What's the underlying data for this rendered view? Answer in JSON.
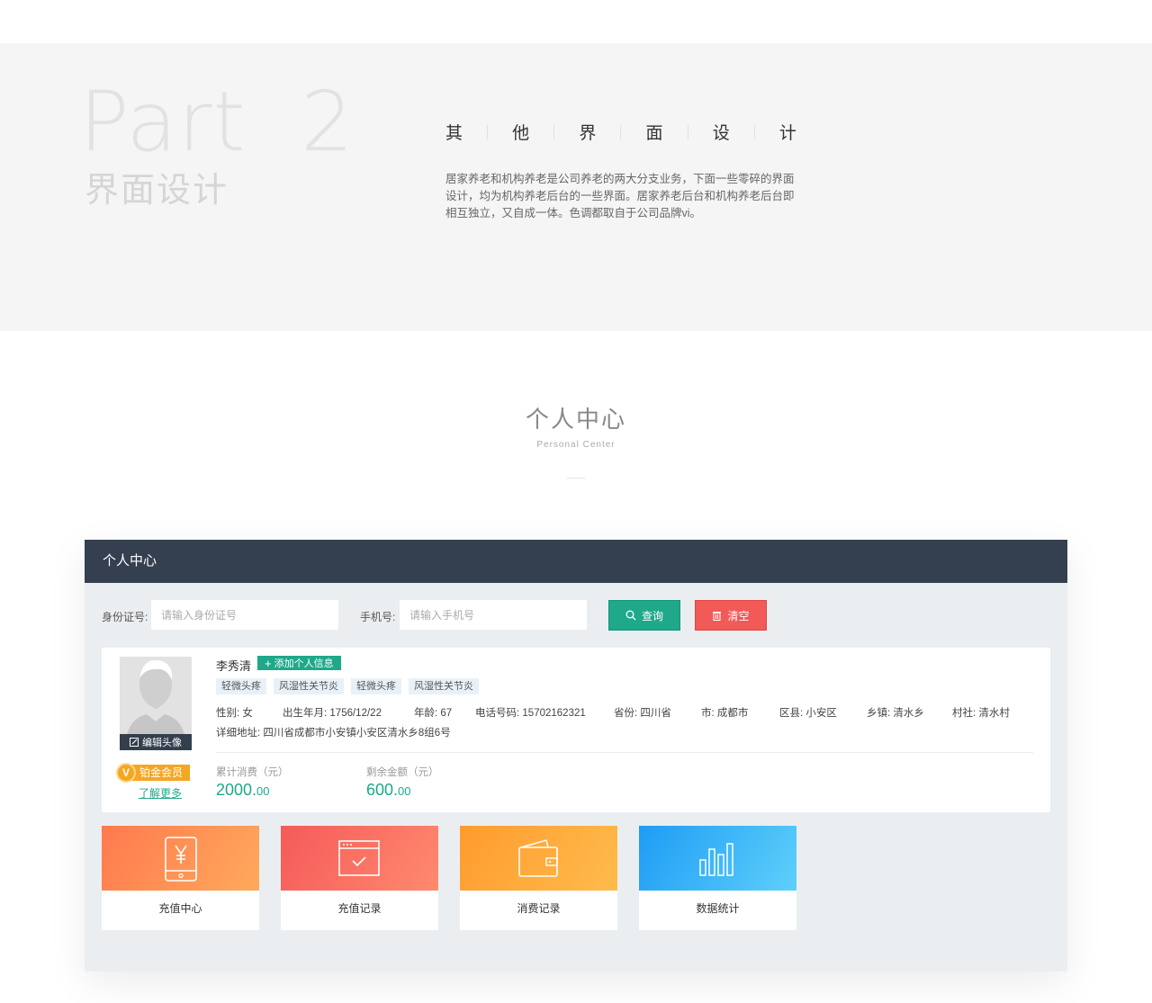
{
  "intro": {
    "part": "Part  2",
    "sub": "界面设计",
    "title_chars": [
      "其",
      "他",
      "界",
      "面",
      "设",
      "计"
    ],
    "desc": "居家养老和机构养老是公司养老的两大分支业务，下面一些零碎的界面设计，均为机构养老后台的一些界面。居家养老后台和机构养老后台即相互独立，又自成一体。色调都取自于公司品牌vi。"
  },
  "section": {
    "title": "个人中心",
    "subtitle": "Personal Center"
  },
  "panel": {
    "header": "个人中心",
    "search": {
      "id_label": "身份证号:",
      "id_placeholder": "请输入身份证号",
      "phone_label": "手机号:",
      "phone_placeholder": "请输入手机号",
      "query_label": "查询",
      "clear_label": "清空"
    },
    "profile": {
      "edit_avatar": "编辑头像",
      "member_badge": "V",
      "member_level": "铂金会员",
      "learn_more": "了解更多",
      "name": "李秀清",
      "add_info": "添加个人信息",
      "tags": [
        "轻微头疼",
        "风湿性关节炎",
        "轻微头疼",
        "风湿性关节炎"
      ],
      "details": {
        "gender_label": "性别:",
        "gender": "女",
        "birth_label": "出生年月:",
        "birth": "1756/12/22",
        "age_label": "年龄:",
        "age": "67",
        "phone_label": "电话号码:",
        "phone": "15702162321",
        "province_label": "省份:",
        "province": "四川省",
        "city_label": "市:",
        "city": "成都市",
        "district_label": "区县:",
        "district": "小安区",
        "town_label": "乡镇:",
        "town": "清水乡",
        "village_label": "村社:",
        "village": "清水村",
        "address_label": "详细地址:",
        "address": "四川省成都市小安镇小安区清水乡8组6号"
      },
      "stats": {
        "spent_label": "累计消费（元）",
        "spent_int": "2000.",
        "spent_dec": "00",
        "balance_label": "剩余金额（元）",
        "balance_int": "600.",
        "balance_dec": "00"
      }
    },
    "tiles": [
      {
        "label": "充值中心",
        "icon": "phone-yuan-icon"
      },
      {
        "label": "充值记录",
        "icon": "window-check-icon"
      },
      {
        "label": "消费记录",
        "icon": "wallet-icon"
      },
      {
        "label": "数据统计",
        "icon": "bar-chart-icon"
      }
    ]
  },
  "colors": {
    "accent": "#1fa88a",
    "danger": "#f15a57",
    "header": "#34404f",
    "gold": "#f5a623"
  }
}
